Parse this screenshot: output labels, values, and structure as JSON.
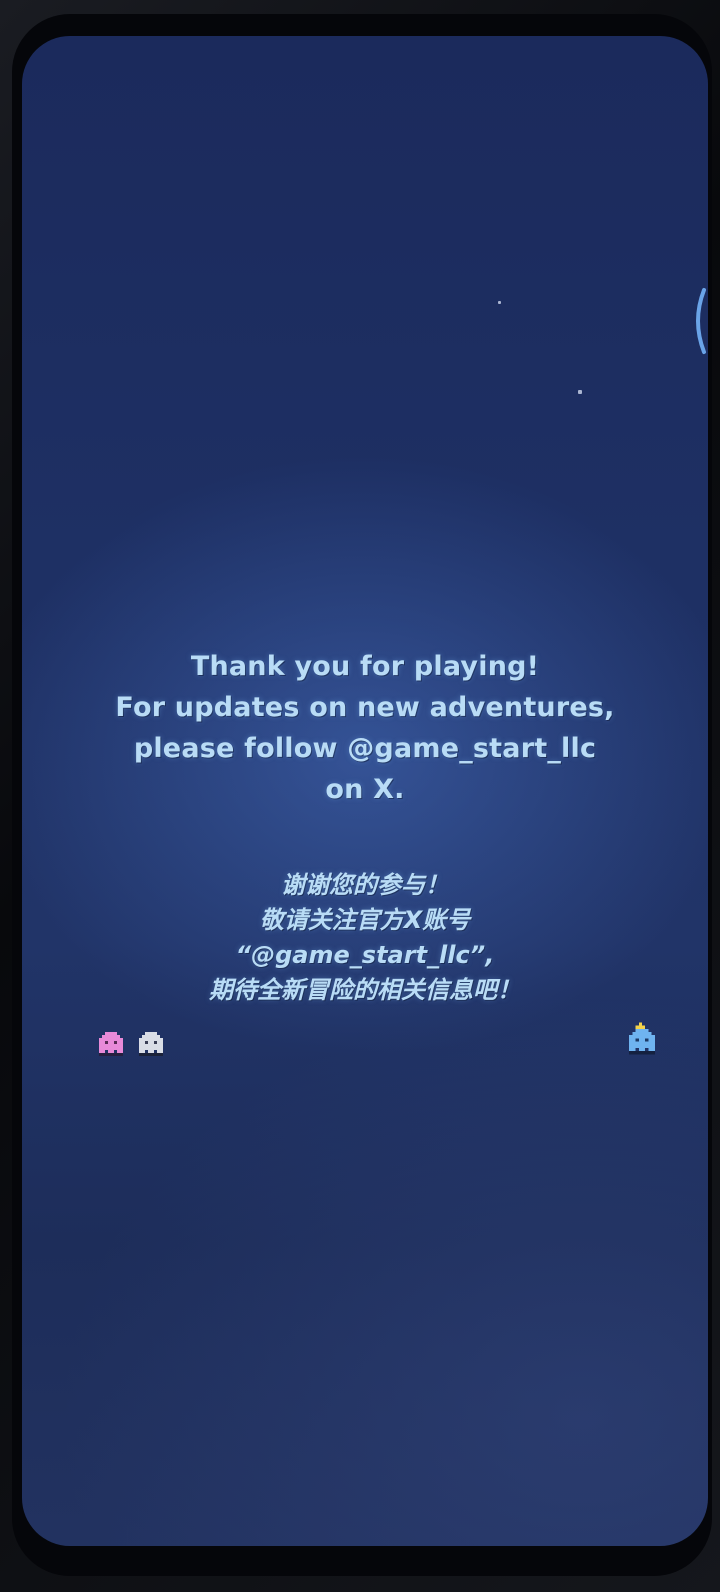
{
  "message": {
    "english_lines": [
      "Thank you for playing!",
      "For updates on new adventures,",
      "please follow @game_start_llc",
      "on X."
    ],
    "chinese_lines": [
      "谢谢您的参与！",
      "敬请关注官方X账号",
      "“@game_start_llc”,",
      "期待全新冒险的相关信息吧！"
    ]
  },
  "sprites": [
    {
      "name": "pink-ghost-sprite",
      "color": "#e88ad8"
    },
    {
      "name": "white-ghost-sprite",
      "color": "#d9dde6"
    },
    {
      "name": "blue-crowned-ghost-sprite",
      "color": "#6fb4f0"
    }
  ],
  "colors": {
    "background": "#1e3064",
    "text": "#b9dcf6"
  }
}
